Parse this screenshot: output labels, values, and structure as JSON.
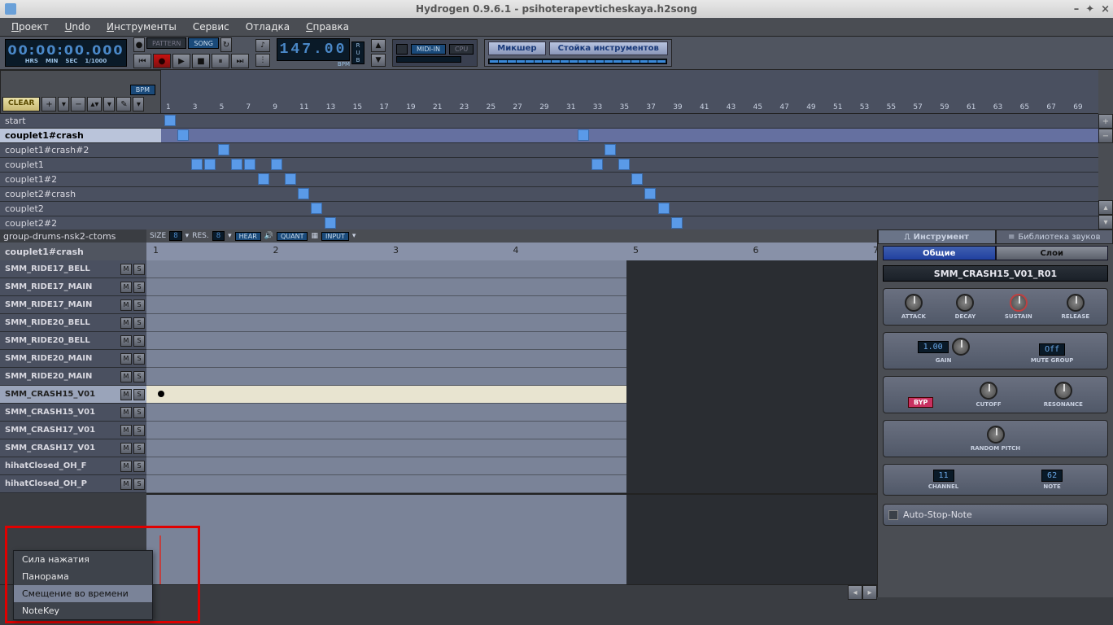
{
  "window": {
    "title": "Hydrogen 0.9.6.1 - psihoterapevticheskaya.h2song"
  },
  "menu": {
    "project": "Проект",
    "undo": "Undo",
    "instruments": "Инструменты",
    "service": "Сервис",
    "debug": "Отладка",
    "help": "Справка"
  },
  "transport": {
    "time": "00:00:00.000",
    "time_labels": [
      "HRS",
      "MIN",
      "SEC",
      "1/1000"
    ],
    "mode_pattern": "PATTERN",
    "mode_song": "SONG",
    "bpm_value": "147.00",
    "bpm_label": "BPM",
    "rub": "R U B",
    "midi_in": "MIDI-IN",
    "cpu": "CPU",
    "mixer": "Микшер",
    "rack": "Стойка инструментов"
  },
  "song_toolbar": {
    "bpm_badge": "BPM",
    "clear": "CLEAR"
  },
  "ruler_bars": [
    "1",
    "3",
    "5",
    "7",
    "9",
    "11",
    "13",
    "15",
    "17",
    "19",
    "21",
    "23",
    "25",
    "27",
    "29",
    "31",
    "33",
    "35",
    "37",
    "39",
    "41",
    "43",
    "45",
    "47",
    "49",
    "51",
    "53",
    "55",
    "57",
    "59",
    "61",
    "63",
    "65",
    "67",
    "69"
  ],
  "patterns": [
    {
      "name": "start",
      "cells": [
        0
      ]
    },
    {
      "name": "couplet1#crash",
      "selected": true,
      "cells": [
        1,
        31
      ]
    },
    {
      "name": "couplet1#crash#2",
      "cells": [
        4,
        33
      ]
    },
    {
      "name": "couplet1",
      "cells": [
        2,
        3,
        5,
        6,
        8,
        32,
        34
      ]
    },
    {
      "name": "couplet1#2",
      "cells": [
        7,
        9,
        35
      ]
    },
    {
      "name": "couplet2#crash",
      "cells": [
        10,
        36
      ]
    },
    {
      "name": "couplet2",
      "cells": [
        11,
        37
      ]
    },
    {
      "name": "couplet2#2",
      "cells": [
        12,
        38
      ]
    }
  ],
  "pattern_editor": {
    "kit_name": "group-drums-nsk2-ctoms",
    "pattern_name": "couplet1#crash",
    "size_label": "SIZE",
    "size_value": "8",
    "res_label": "RES.",
    "res_value": "8",
    "hear": "HEAR",
    "quant": "QUANT",
    "input": "INPUT",
    "ruler": [
      "1",
      "2",
      "3",
      "4",
      "5",
      "6",
      "7"
    ]
  },
  "instruments": [
    "SMM_RIDE17_BELL",
    "SMM_RIDE17_MAIN",
    "SMM_RIDE17_MAIN",
    "SMM_RIDE20_BELL",
    "SMM_RIDE20_BELL",
    "SMM_RIDE20_MAIN",
    "SMM_RIDE20_MAIN",
    "SMM_CRASH15_V01",
    "SMM_CRASH15_V01",
    "SMM_CRASH17_V01",
    "SMM_CRASH17_V01",
    "hihatClosed_OH_F",
    "hihatClosed_OH_P"
  ],
  "selected_instrument_index": 7,
  "context_menu": {
    "items": [
      "Сила нажатия",
      "Панорама",
      "Смещение во времени",
      "NoteKey"
    ],
    "highlighted": 2
  },
  "props": {
    "tab_instrument": "Инструмент",
    "tab_library": "Библиотека звуков",
    "sub_general": "Общие",
    "sub_layers": "Слои",
    "inst_name": "SMM_CRASH15_V01_R01",
    "adsr": [
      "ATTACK",
      "DECAY",
      "SUSTAIN",
      "RELEASE"
    ],
    "gain_value": "1.00",
    "gain_label": "GAIN",
    "mute_value": "Off",
    "mute_label": "MUTE GROUP",
    "byp": "BYP",
    "cutoff": "CUTOFF",
    "resonance": "RESONANCE",
    "random_pitch": "RANDOM PITCH",
    "channel_value": "11",
    "channel_label": "CHANNEL",
    "note_value": "62",
    "note_label": "NOTE",
    "autostop": "Auto-Stop-Note"
  }
}
